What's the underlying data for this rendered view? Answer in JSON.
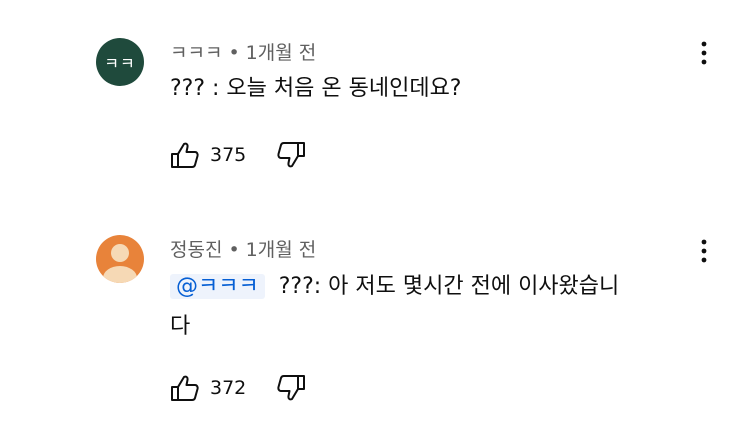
{
  "comments": [
    {
      "avatar_text": "ㅋㅋ",
      "author": "ㅋㅋㅋ",
      "separator": "•",
      "time": "1개월 전",
      "mention": "",
      "text_line1": "??? : 오늘 처음 온 동네인데요?",
      "text_line2": "",
      "likes": "375",
      "icons": {
        "like": "thumbs-up-icon",
        "dislike": "thumbs-down-icon",
        "more": "more-vert-icon"
      }
    },
    {
      "avatar_text": "",
      "author": "정동진",
      "separator": "•",
      "time": "1개월 전",
      "mention": "@ㅋㅋㅋ",
      "text_line1": "???: 아 저도 몇시간 전에 이사왔습니",
      "text_line2": "다",
      "likes": "372",
      "icons": {
        "like": "thumbs-up-icon",
        "dislike": "thumbs-down-icon",
        "more": "more-vert-icon"
      }
    }
  ],
  "colors": {
    "avatar1_bg": "#1f4a3c",
    "avatar2_bg": "#e8833a",
    "mention": "#065fd4",
    "meta": "#606060"
  }
}
